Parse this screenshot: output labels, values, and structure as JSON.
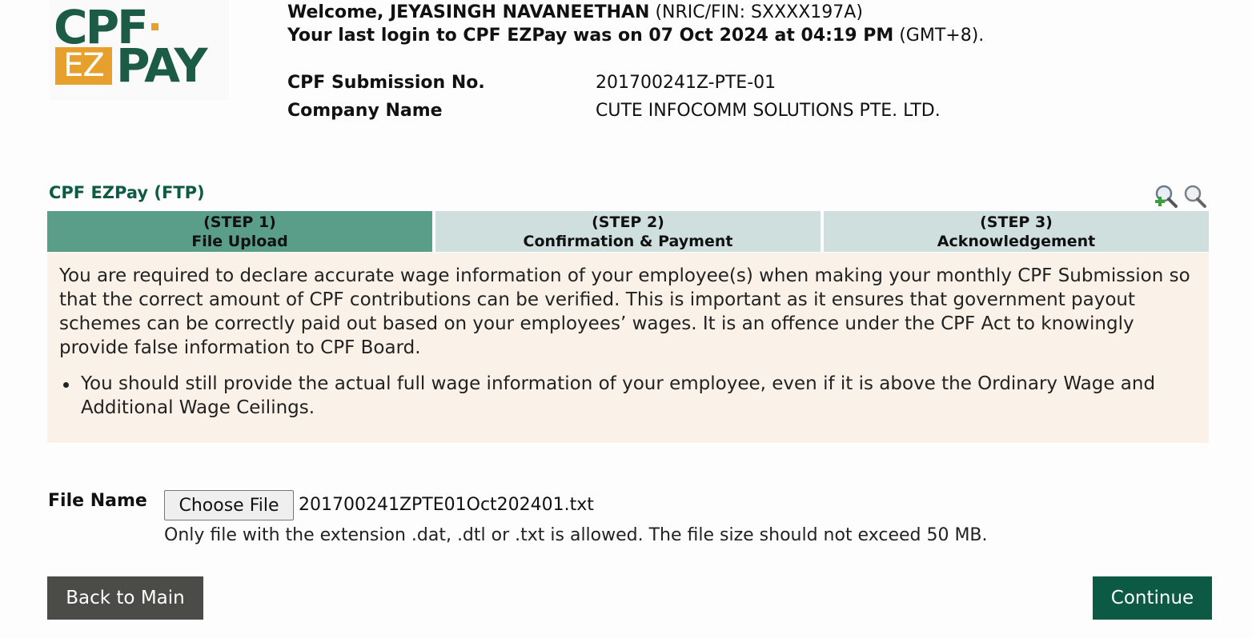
{
  "logo": {
    "line1": "CPF",
    "ez": "EZ",
    "pay": "PAY"
  },
  "header": {
    "welcome_prefix": "Welcome, JEYASINGH NAVANEETHAN",
    "nric": "(NRIC/FIN: SXXXX197A)",
    "last_login_text": "Your last login to CPF EZPay was on 07 Oct 2024 at 04:19 PM",
    "timezone": "(GMT+8)."
  },
  "info": {
    "submission_label": "CPF Submission No.",
    "submission_value": "201700241Z-PTE-01",
    "company_label": "Company Name",
    "company_value": "CUTE INFOCOMM SOLUTIONS PTE. LTD."
  },
  "section_title": "CPF EZPay (FTP)",
  "steps": [
    {
      "num": "(STEP 1)",
      "label": "File Upload",
      "active": true
    },
    {
      "num": "(STEP 2)",
      "label": "Confirmation & Payment",
      "active": false
    },
    {
      "num": "(STEP 3)",
      "label": "Acknowledgement",
      "active": false
    }
  ],
  "notice": {
    "paragraph": "You are required to declare accurate wage information of your employee(s) when making your monthly CPF Submission so that the correct amount of CPF contributions can be verified. This is important as it ensures that government payout schemes can be correctly paid out based on your employees’ wages. It is an offence under the CPF Act to knowingly provide false information to CPF Board.",
    "bullet": "You should still provide the actual full wage information of your employee, even if it is above the Ordinary Wage and Additional Wage Ceilings."
  },
  "file_upload": {
    "label": "File Name",
    "button_label": "Choose File",
    "selected_file": "201700241ZPTE01Oct202401.txt",
    "hint": "Only file with the extension .dat, .dtl or .txt is allowed. The file size should not exceed 50 MB."
  },
  "buttons": {
    "back": "Back to Main",
    "continue": "Continue"
  },
  "colors": {
    "brand_green": "#0c5a43",
    "step_active": "#5a9e8a",
    "step_inactive": "#cfdfdd",
    "notice_bg": "#faf1e8",
    "logo_orange": "#e8a02d"
  },
  "icons": {
    "zoom_in": "zoom-in-icon",
    "zoom_out": "zoom-out-icon"
  }
}
